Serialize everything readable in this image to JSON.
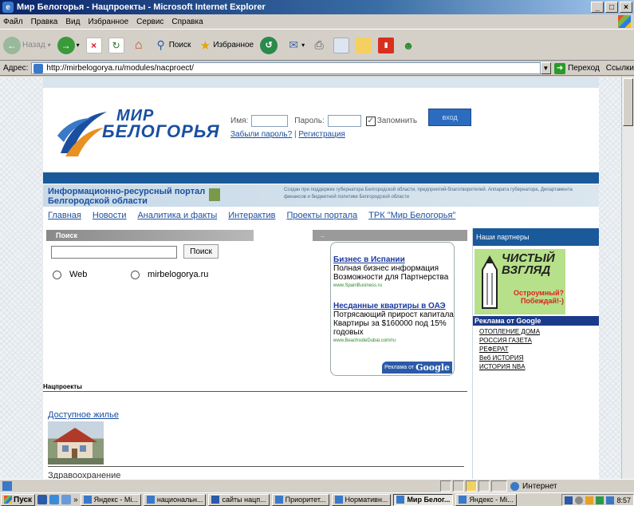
{
  "window": {
    "title": "Мир Белогорья - Нацпроекты - Microsoft Internet Explorer",
    "buttons": [
      "_",
      "□",
      "×"
    ]
  },
  "menu": [
    "Файл",
    "Правка",
    "Вид",
    "Избранное",
    "Сервис",
    "Справка"
  ],
  "toolbar": {
    "back": "Назад",
    "search": "Поиск",
    "favorites": "Избранное"
  },
  "address": {
    "label": "Адрес:",
    "url": "http://mirbelogorya.ru/modules/nacproect/",
    "go": "Переход",
    "links": "Ссылки"
  },
  "site": {
    "logo_line1": "МИР",
    "logo_line2": "БЕЛОГОРЬЯ",
    "login": {
      "name_label": "Имя:",
      "password_label": "Пароль:",
      "remember_label": "Запомнить",
      "remember_checked": true,
      "button": "вход",
      "forgot": "Забыли пароль?",
      "separator": "|",
      "register": "Регистрация"
    },
    "portal_title_1": "Информационно-ресурсный портал",
    "portal_title_2": "Белгородской области",
    "portal_desc": "Создан при поддержке губернатора Белгородской области, предприятий-благотворителей. Аппарата губернатора, Департамента финансов и бюджетной политики Белгородской области",
    "nav": [
      "Главная",
      "Новости",
      "Аналитика и факты",
      "Интерактив",
      "Проекты портала",
      "ТРК \"Мир Белогорья\""
    ],
    "search": {
      "header": "Поиск",
      "button": "Поиск",
      "option_web": "Web",
      "option_site": "mirbelogorya.ru"
    },
    "ad_header": "..",
    "ads": [
      {
        "title": "Бизнес в Испании",
        "line1": "Полная бизнес информация",
        "line2": "Возможности для Партнерства",
        "url": "www.SpainBusiness.ru"
      },
      {
        "title": "Несданные квартиры в ОАЭ",
        "line1": "Потрясающий прирост капитала",
        "line2": "Квартиры за $160000 под 15% годовых",
        "url": "www.BeachsideDubai.com/ru"
      }
    ],
    "ads_by": "Реклама от",
    "ads_google": "Google",
    "partners": {
      "header": "Наши партнеры",
      "banner_line1": "ЧИСТЫЙ",
      "banner_line2": "ВЗГЛЯД",
      "banner_tag1": "Остроумный?",
      "banner_tag2": "Побеждай!-)",
      "google_header": "Реклама от Google",
      "google_links": [
        "ОТОПЛЕНИЕ ДОМА",
        "РОССИЯ ГАЗЕТА",
        "РЕФЕРАТ",
        "Веб ИСТОРИЯ",
        "ИСТОРИЯ NBA"
      ]
    },
    "section_title": "Нацпроекты",
    "project_link": "Доступное жилье",
    "next_project": "Здравоохранение"
  },
  "status": {
    "zone": "Интернет"
  },
  "taskbar": {
    "start": "Пуск",
    "more": "»",
    "tasks": [
      {
        "label": "Яндекс - Mi...",
        "active": false
      },
      {
        "label": "национальн...",
        "active": false
      },
      {
        "label": "сайты нацп...",
        "active": false
      },
      {
        "label": "Приоритет...",
        "active": false
      },
      {
        "label": "Нормативн...",
        "active": false
      },
      {
        "label": "Мир Белог...",
        "active": true
      },
      {
        "label": "Яндекс - Mi...",
        "active": false
      }
    ],
    "clock": "8:57"
  },
  "colors": {
    "title_bar": "#0a246a",
    "site_blue": "#1a5a9a",
    "link": "#1a4fa0"
  }
}
